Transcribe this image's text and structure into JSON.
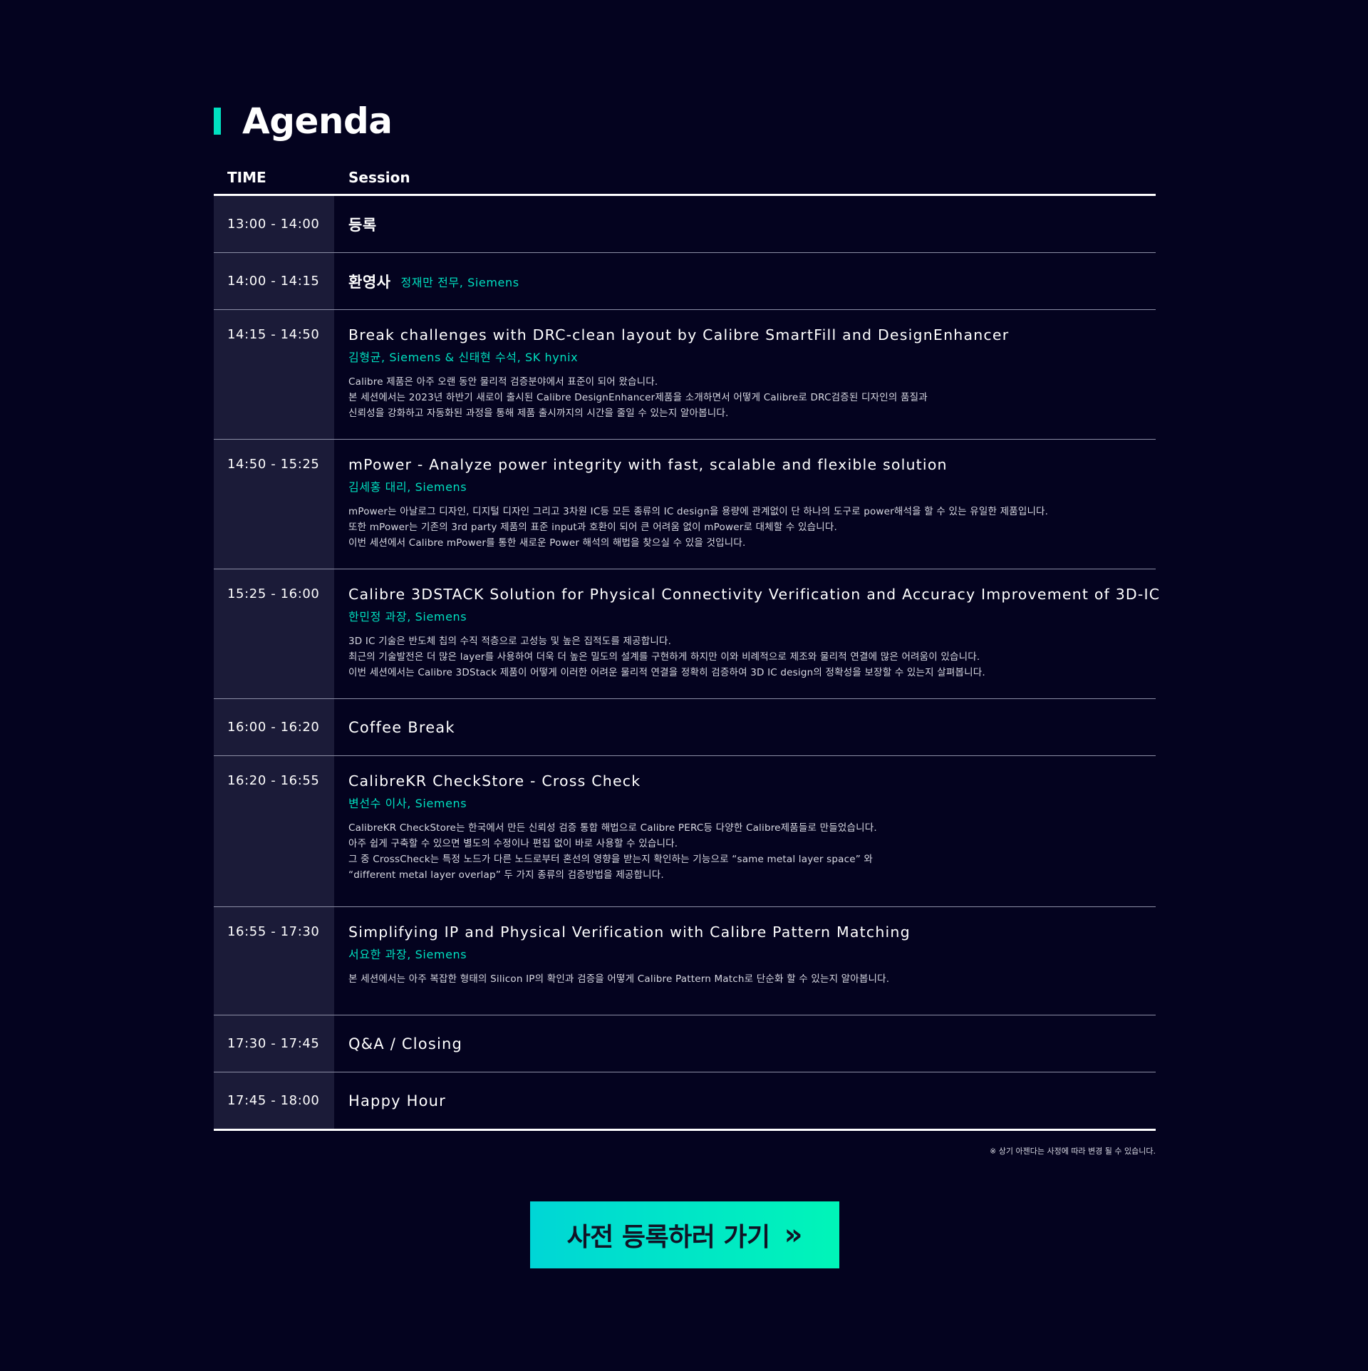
{
  "heading": {
    "title": "Agenda"
  },
  "table": {
    "col_time": "TIME",
    "col_session": "Session"
  },
  "rows": [
    {
      "time": "13:00 - 14:00",
      "title": "등록"
    },
    {
      "time": "14:00 - 14:15",
      "title": "환영사",
      "speaker": "정재만 전무, Siemens"
    },
    {
      "time": "14:15 - 14:50",
      "title": "Break challenges with DRC-clean layout by Calibre SmartFill and DesignEnhancer",
      "speaker": "김형균, Siemens & 신태현 수석, SK hynix",
      "desc": [
        "Calibre 제품은 아주 오랜 동안 물리적 검증분야에서 표준이 되어 왔습니다.",
        "본 세션에서는 2023년 하반기 새로이 출시된 Calibre DesignEnhancer제품을 소개하면서  어떻게 Calibre로 DRC검증된 디자인의 품질과",
        "신뢰성을 강화하고 자동화된 과정을 통해 제품 출시까지의 시간을 줄일 수 있는지 알아봅니다."
      ]
    },
    {
      "time": "14:50 - 15:25",
      "title": "mPower - Analyze power integrity with fast, scalable and flexible solution",
      "speaker": "김세홍 대리, Siemens",
      "desc": [
        "mPower는 아날로그 디자인, 디지털 디자인 그리고 3차원 IC등 모든 종류의 IC design을 용량에 관계없이 단 하나의 도구로 power해석을 할 수 있는 유일한 제품입니다.",
        "또한 mPower는 기존의 3rd party 제품의 표준 input과 호환이 되어 큰 어려움 없이 mPower로 대체할 수 있습니다.",
        "이번 세션에서 Calibre mPower를 통한 새로운 Power 해석의 해법을 찾으실 수 있을 것입니다."
      ]
    },
    {
      "time": "15:25 - 16:00",
      "title": "Calibre 3DSTACK Solution for Physical Connectivity Verification and Accuracy Improvement of 3D-IC",
      "speaker": "한민정 과장, Siemens",
      "desc": [
        "3D IC 기술은 반도체 칩의 수직 적층으로 고성능 및 높은 집적도를 제공합니다.",
        "최근의 기술발전은 더 많은 layer를 사용하여 더욱 더 높은 밀도의 설계를 구현하게 하지만 이와 비례적으로 제조와 물리적 연결에 많은 어려움이 있습니다.",
        "이번 세션에서는 Calibre 3DStack 제품이 어떻게 이러한 어려운 물리적 연결을 정확히 검증하여 3D IC design의 정확성을 보장할 수 있는지 살펴봅니다."
      ]
    },
    {
      "time": "16:00 - 16:20",
      "title": "Coffee Break"
    },
    {
      "time": "16:20 - 16:55",
      "title": "CalibreKR CheckStore - Cross Check",
      "speaker": "변선수 이사, Siemens",
      "desc": [
        "CalibreKR CheckStore는 한국에서 만든 신뢰성 검증 통합 해법으로 Calibre PERC등 다양한 Calibre제품들로 만들었습니다.",
        "아주 쉽게 구축할 수 있으면 별도의 수정이나 편집 없이 바로 사용할 수 있습니다.",
        "그 중 CrossCheck는 특정 노드가 다른 노드로부터 혼선의 영향을 받는지 확인하는 기능으로 “same metal layer space” 와",
        "“different metal layer overlap” 두 가지 종류의 검증방법을 제공합니다."
      ]
    },
    {
      "time": "16:55 - 17:30",
      "title": "Simplifying IP and Physical Verification with Calibre Pattern Matching",
      "speaker": "서요한 과장, Siemens",
      "desc": [
        "본 세션에서는 아주 복잡한 형태의 Silicon IP의 확인과 검증을 어떻게 Calibre Pattern Match로 단순화 할 수 있는지 알아봅니다."
      ]
    },
    {
      "time": "17:30 - 17:45",
      "title": "Q&A / Closing"
    },
    {
      "time": "17:45 - 18:00",
      "title": "Happy Hour"
    }
  ],
  "note": "※ 상기 아젠다는 사정에 따라 변경 될 수 있습니다.",
  "cta": {
    "label": "사전 등록하러 가기",
    "icon": "double-chevron-right-icon",
    "glyph": "»"
  },
  "colors": {
    "background": "#04031f",
    "accent": "#00e0c0",
    "time_cell": "#1b1b38"
  }
}
